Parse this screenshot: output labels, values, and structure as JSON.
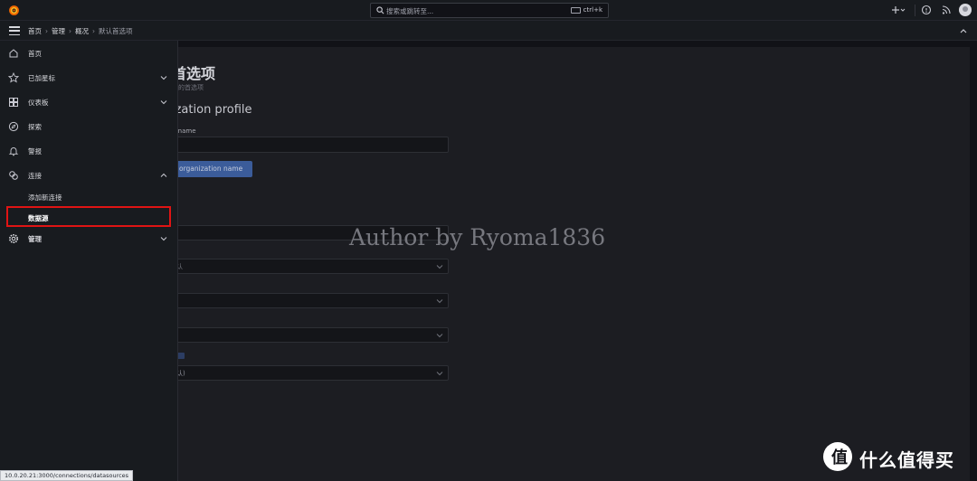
{
  "search": {
    "placeholder": "搜索或跳转至...",
    "shortcut": "ctrl+k"
  },
  "breadcrumb": [
    "首页",
    "管理",
    "概况",
    "默认首选项"
  ],
  "menu": {
    "home": "首页",
    "starred": "已加星标",
    "dashboards": "仪表板",
    "explore": "探索",
    "alerting": "警报",
    "connections": "连接",
    "add_connection": "添加新连接",
    "data_sources": "数据源",
    "administration": "管理"
  },
  "page": {
    "title_fragment": "首选项",
    "subtitle_fragment": "织的首选项",
    "section_fragment": "ization profile",
    "label_fragment": "n name",
    "button_fragment": "organization name",
    "select_value_1": "认",
    "select_value_4": "认)"
  },
  "watermark": "Author by Ryoma1836",
  "status_url": "10.0.20.21:3000/connections/datasources",
  "brand": "什么值得买",
  "icons": [
    "grafana-logo-icon",
    "search-icon",
    "keyboard-icon",
    "plus-icon",
    "help-icon",
    "rss-icon",
    "user-avatar",
    "hamburger-icon",
    "chevron-up-icon"
  ],
  "colors": {
    "highlight": "#e01414",
    "primary_button": "#3b5c9a",
    "background": "#111217"
  }
}
